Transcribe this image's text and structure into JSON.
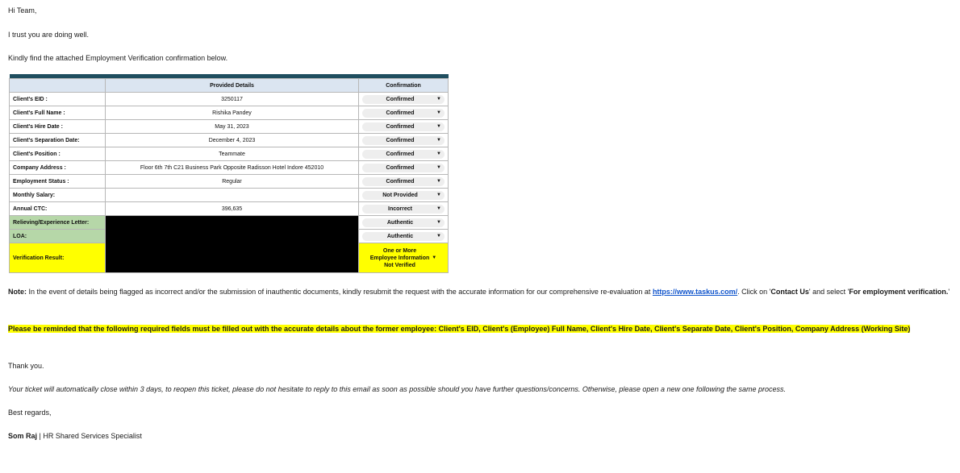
{
  "email": {
    "greeting": "Hi Team,",
    "intro1": "I trust you are doing well.",
    "intro2": "Kindly find the attached Employment Verification confirmation below.",
    "note_label": "Note:",
    "note_text": " In the event of details being flagged as incorrect and/or the submission of inauthentic documents, kindly resubmit the request with the accurate information for our comprehensive re-evaluation at ",
    "note_link": "https://www.taskus.com/",
    "note_after_link": ". Click on '",
    "note_contact": "Contact Us",
    "note_and_select": "' and select '",
    "note_for": "For employment verification.",
    "note_end": "'",
    "reminder": "Please be reminded that the following required fields must be filled out with the accurate details about the former employee: Client's EID, Client's (Employee) Full Name, Client's Hire Date, Client's Separate Date, Client's Position, Company Address (Working Site)",
    "thanks": "Thank you.",
    "auto_close": "Your ticket will automatically close within 3 days, to reopen this ticket, please do not hesitate to reply to this email as soon as possible should you have further questions/concerns. Otherwise, please open a new one following the same process.",
    "regards": "Best regards,",
    "sig_name": "Som Raj",
    "sig_sep": " | ",
    "sig_title": "HR Shared Services Specialist"
  },
  "table": {
    "headers": {
      "label": "",
      "details": "Provided Details",
      "confirmation": "Confirmation"
    },
    "rows": [
      {
        "label": "Client's EID :",
        "value": "3250117",
        "status": "Confirmed"
      },
      {
        "label": "Client's Full Name :",
        "value": "Rishika Pandey",
        "status": "Confirmed"
      },
      {
        "label": "Client's Hire Date :",
        "value": "May 31, 2023",
        "status": "Confirmed"
      },
      {
        "label": "Client's Separation Date:",
        "value": "December 4, 2023",
        "status": "Confirmed"
      },
      {
        "label": "Client's Position  :",
        "value": "Teammate",
        "status": "Confirmed"
      },
      {
        "label": "Company Address :",
        "value": "Floor 6th 7th C21 Business Park Opposite Radisson Hotel Indore 452010",
        "status": "Confirmed"
      },
      {
        "label": "Employment Status :",
        "value": "Regular",
        "status": "Confirmed"
      },
      {
        "label": "Monthly Salary:",
        "value": "",
        "status": "Not Provided"
      },
      {
        "label": "Annual CTC:",
        "value": "396,635",
        "status": "Incorrect"
      },
      {
        "label": "Relieving/Experience Letter:",
        "value": "",
        "status": "Authentic"
      },
      {
        "label": "LOA:",
        "value": "",
        "status": "Authentic"
      },
      {
        "label": "Verification Result:",
        "value": "",
        "status_lines": [
          "One or More",
          "Employee Information",
          "Not Verified"
        ]
      }
    ]
  }
}
